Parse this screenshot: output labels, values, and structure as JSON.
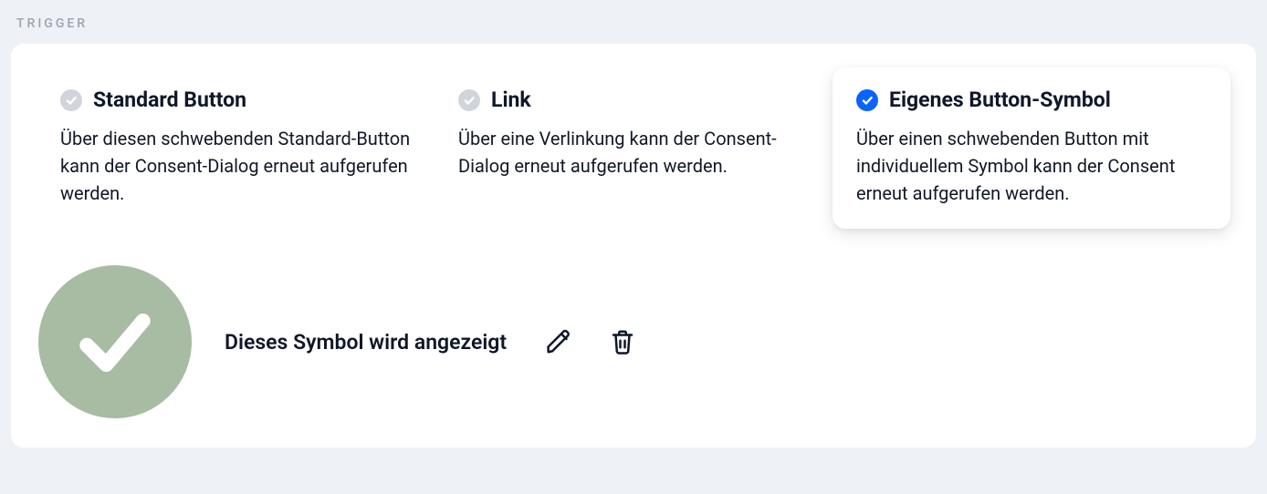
{
  "section_label": "TRIGGER",
  "options": [
    {
      "title": "Standard Button",
      "description": "Über diesen schwebenden Standard-Button kann der Consent-Dialog erneut aufgerufen werden.",
      "selected": false
    },
    {
      "title": "Link",
      "description": "Über eine Verlinkung kann der Consent-Dialog erneut aufgerufen werden.",
      "selected": false
    },
    {
      "title": "Eigenes Button-Symbol",
      "description": "Über einen schwebenden Button mit individuellem Symbol kann der Consent erneut aufgerufen werden.",
      "selected": true
    }
  ],
  "symbol_caption": "Dieses Symbol wird angezeigt"
}
